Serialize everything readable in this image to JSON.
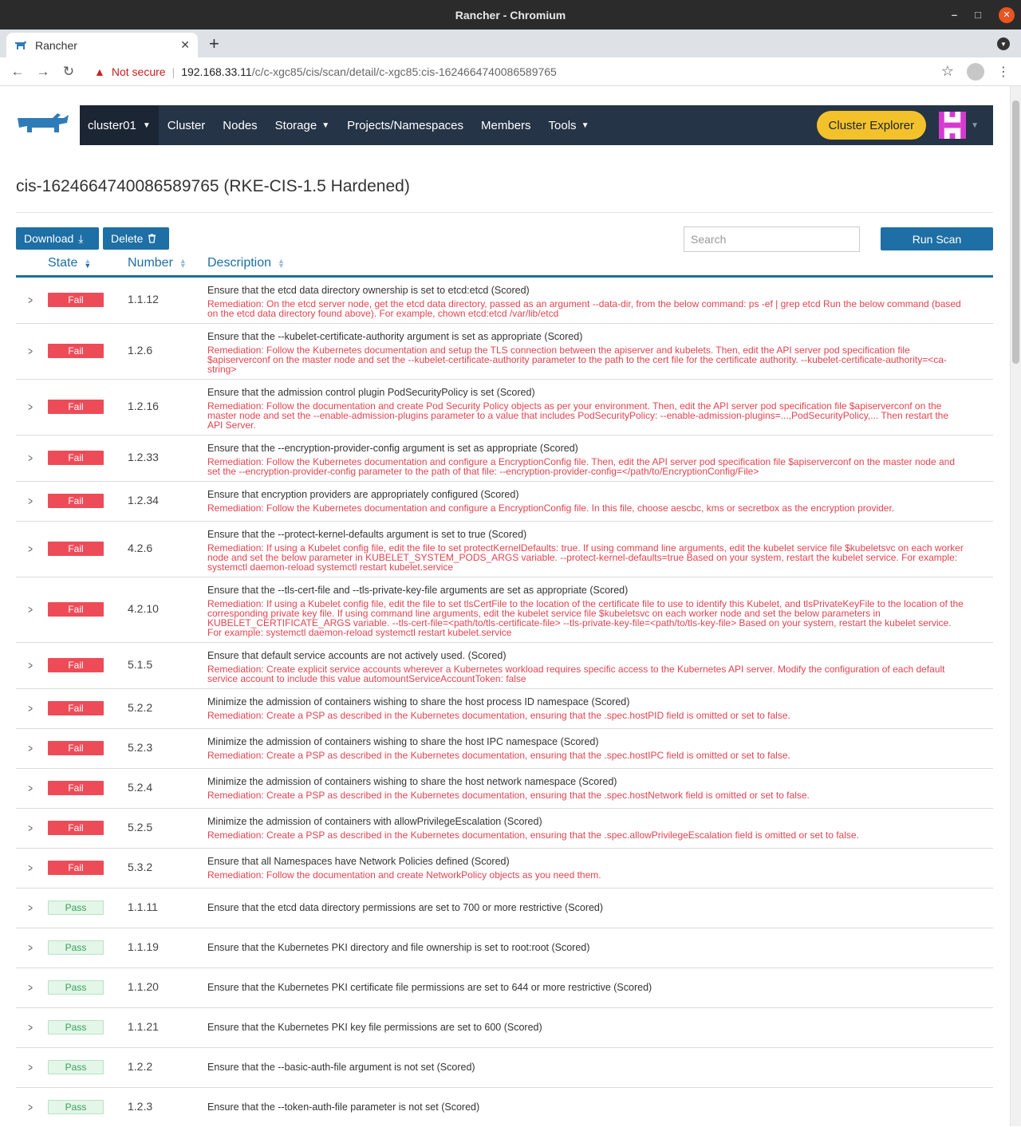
{
  "window": {
    "title": "Rancher - Chromium"
  },
  "browser": {
    "tab_title": "Rancher",
    "security_label": "Not secure",
    "url_host": "192.168.33.11",
    "url_path": "/c/c-xgc85/cis/scan/detail/c-xgc85:cis-1624664740086589765"
  },
  "nav": {
    "cluster": "cluster01",
    "items": [
      "Cluster",
      "Nodes",
      "Storage",
      "Projects/Namespaces",
      "Members",
      "Tools"
    ],
    "explorer_button": "Cluster Explorer"
  },
  "page": {
    "title": "cis-1624664740086589765 (RKE-CIS-1.5 Hardened)",
    "download_label": "Download",
    "delete_label": "Delete",
    "search_placeholder": "Search",
    "run_scan_label": "Run Scan"
  },
  "table": {
    "columns": [
      "State",
      "Number",
      "Description"
    ],
    "rows": [
      {
        "state": "Fail",
        "number": "1.1.12",
        "description": "Ensure that the etcd data directory ownership is set to etcd:etcd (Scored)",
        "remediation": "Remediation: On the etcd server node, get the etcd data directory, passed as an argument --data-dir, from the below command: ps -ef | grep etcd Run the below command (based on the etcd data directory found above). For example, chown etcd:etcd /var/lib/etcd"
      },
      {
        "state": "Fail",
        "number": "1.2.6",
        "description": "Ensure that the --kubelet-certificate-authority argument is set as appropriate (Scored)",
        "remediation": "Remediation: Follow the Kubernetes documentation and setup the TLS connection between the apiserver and kubelets. Then, edit the API server pod specification file $apiserverconf on the master node and set the --kubelet-certificate-authority parameter to the path to the cert file for the certificate authority. --kubelet-certificate-authority=<ca-string>"
      },
      {
        "state": "Fail",
        "number": "1.2.16",
        "description": "Ensure that the admission control plugin PodSecurityPolicy is set (Scored)",
        "remediation": "Remediation: Follow the documentation and create Pod Security Policy objects as per your environment. Then, edit the API server pod specification file $apiserverconf on the master node and set the --enable-admission-plugins parameter to a value that includes PodSecurityPolicy: --enable-admission-plugins=...,PodSecurityPolicy,... Then restart the API Server."
      },
      {
        "state": "Fail",
        "number": "1.2.33",
        "description": "Ensure that the --encryption-provider-config argument is set as appropriate (Scored)",
        "remediation": "Remediation: Follow the Kubernetes documentation and configure a EncryptionConfig file. Then, edit the API server pod specification file $apiserverconf on the master node and set the --encryption-provider-config parameter to the path of that file: --encryption-provider-config=</path/to/EncryptionConfig/File>"
      },
      {
        "state": "Fail",
        "number": "1.2.34",
        "description": "Ensure that encryption providers are appropriately configured (Scored)",
        "remediation": "Remediation: Follow the Kubernetes documentation and configure a EncryptionConfig file. In this file, choose aescbc, kms or secretbox as the encryption provider."
      },
      {
        "state": "Fail",
        "number": "4.2.6",
        "description": "Ensure that the --protect-kernel-defaults argument is set to true (Scored)",
        "remediation": "Remediation: If using a Kubelet config file, edit the file to set protectKernelDefaults: true. If using command line arguments, edit the kubelet service file $kubeletsvc on each worker node and set the below parameter in KUBELET_SYSTEM_PODS_ARGS variable. --protect-kernel-defaults=true Based on your system, restart the kubelet service. For example: systemctl daemon-reload systemctl restart kubelet.service"
      },
      {
        "state": "Fail",
        "number": "4.2.10",
        "description": "Ensure that the --tls-cert-file and --tls-private-key-file arguments are set as appropriate (Scored)",
        "remediation": "Remediation: If using a Kubelet config file, edit the file to set tlsCertFile to the location of the certificate file to use to identify this Kubelet, and tlsPrivateKeyFile to the location of the corresponding private key file. If using command line arguments, edit the kubelet service file $kubeletsvc on each worker node and set the below parameters in KUBELET_CERTIFICATE_ARGS variable. --tls-cert-file=<path/to/tls-certificate-file> --tls-private-key-file=<path/to/tls-key-file> Based on your system, restart the kubelet service. For example: systemctl daemon-reload systemctl restart kubelet.service"
      },
      {
        "state": "Fail",
        "number": "5.1.5",
        "description": "Ensure that default service accounts are not actively used. (Scored)",
        "remediation": "Remediation: Create explicit service accounts wherever a Kubernetes workload requires specific access to the Kubernetes API server. Modify the configuration of each default service account to include this value automountServiceAccountToken: false"
      },
      {
        "state": "Fail",
        "number": "5.2.2",
        "description": "Minimize the admission of containers wishing to share the host process ID namespace (Scored)",
        "remediation": "Remediation: Create a PSP as described in the Kubernetes documentation, ensuring that the .spec.hostPID field is omitted or set to false."
      },
      {
        "state": "Fail",
        "number": "5.2.3",
        "description": "Minimize the admission of containers wishing to share the host IPC namespace (Scored)",
        "remediation": "Remediation: Create a PSP as described in the Kubernetes documentation, ensuring that the .spec.hostIPC field is omitted or set to false."
      },
      {
        "state": "Fail",
        "number": "5.2.4",
        "description": "Minimize the admission of containers wishing to share the host network namespace (Scored)",
        "remediation": "Remediation: Create a PSP as described in the Kubernetes documentation, ensuring that the .spec.hostNetwork field is omitted or set to false."
      },
      {
        "state": "Fail",
        "number": "5.2.5",
        "description": "Minimize the admission of containers with allowPrivilegeEscalation (Scored)",
        "remediation": "Remediation: Create a PSP as described in the Kubernetes documentation, ensuring that the .spec.allowPrivilegeEscalation field is omitted or set to false."
      },
      {
        "state": "Fail",
        "number": "5.3.2",
        "description": "Ensure that all Namespaces have Network Policies defined (Scored)",
        "remediation": "Remediation: Follow the documentation and create NetworkPolicy objects as you need them."
      },
      {
        "state": "Pass",
        "number": "1.1.11",
        "description": "Ensure that the etcd data directory permissions are set to 700 or more restrictive (Scored)",
        "remediation": ""
      },
      {
        "state": "Pass",
        "number": "1.1.19",
        "description": "Ensure that the Kubernetes PKI directory and file ownership is set to root:root (Scored)",
        "remediation": ""
      },
      {
        "state": "Pass",
        "number": "1.1.20",
        "description": "Ensure that the Kubernetes PKI certificate file permissions are set to 644 or more restrictive (Scored)",
        "remediation": ""
      },
      {
        "state": "Pass",
        "number": "1.1.21",
        "description": "Ensure that the Kubernetes PKI key file permissions are set to 600 (Scored)",
        "remediation": ""
      },
      {
        "state": "Pass",
        "number": "1.2.2",
        "description": "Ensure that the --basic-auth-file argument is not set (Scored)",
        "remediation": ""
      },
      {
        "state": "Pass",
        "number": "1.2.3",
        "description": "Ensure that the --token-auth-file parameter is not set (Scored)",
        "remediation": ""
      }
    ]
  }
}
